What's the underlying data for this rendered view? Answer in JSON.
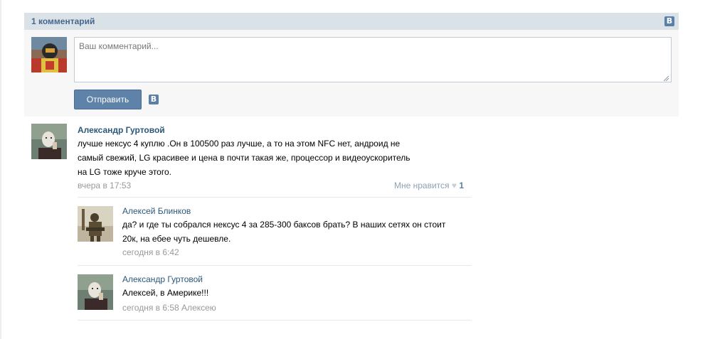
{
  "header": {
    "title": "1 комментарий",
    "vk_badge": "В"
  },
  "composer": {
    "placeholder": "Ваш комментарий...",
    "send_label": "Отправить",
    "vk_badge": "В"
  },
  "comment": {
    "author": "Александр Гуртовой",
    "text_lines": [
      "лучше нексус 4 куплю .Он в 100500 раз лучше, а то на этом NFC нет, андроид не",
      "самый свежий, LG красивее и цена в почти такая же, процессор и видеоускоритель",
      "на LG тоже круче этого."
    ],
    "timestamp": "вчера в 17:53",
    "like_label": "Мне нравится",
    "like_count": "1"
  },
  "replies": [
    {
      "author": "Алексей Блинков",
      "text_lines": [
        "да? и где ты собрался нексус 4 за 285-300 баксов брать? В наших сетях он стоит",
        "20к, на ебее чуть дешевле."
      ],
      "timestamp": "сегодня в 6:42"
    },
    {
      "author": "Александр Гуртовой",
      "text_lines": [
        "Алексей, в Америке!!!"
      ],
      "timestamp": "сегодня в 6:58 Алексею"
    }
  ]
}
